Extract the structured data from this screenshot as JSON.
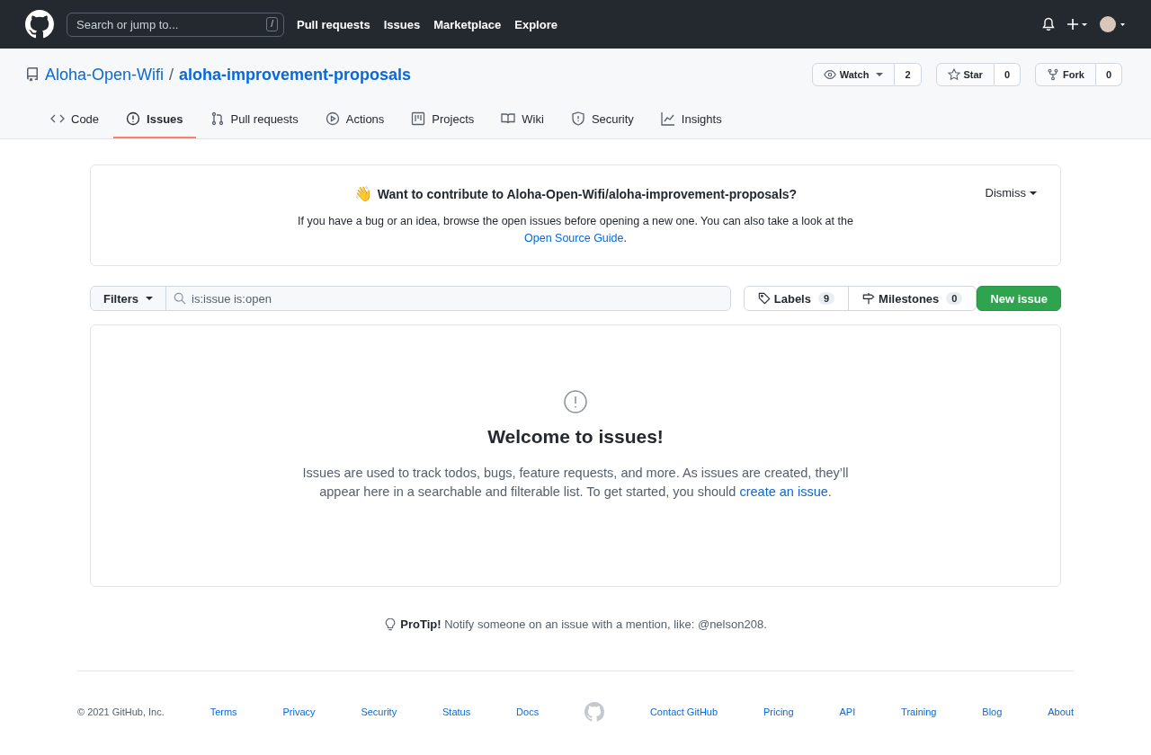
{
  "header": {
    "search_placeholder": "Search or jump to...",
    "slash_key": "/",
    "nav": [
      "Pull requests",
      "Issues",
      "Marketplace",
      "Explore"
    ]
  },
  "repo": {
    "owner": "Aloha-Open-Wifi",
    "separator": "/",
    "name": "aloha-improvement-proposals",
    "actions": [
      {
        "kind": "watch",
        "label": "Watch",
        "count": "2"
      },
      {
        "kind": "star",
        "label": "Star",
        "count": "0"
      },
      {
        "kind": "fork",
        "label": "Fork",
        "count": "0"
      }
    ]
  },
  "tabs": [
    {
      "kind": "code",
      "label": "Code",
      "selected": false
    },
    {
      "kind": "issues",
      "label": "Issues",
      "selected": true
    },
    {
      "kind": "pulls",
      "label": "Pull requests",
      "selected": false
    },
    {
      "kind": "actions",
      "label": "Actions",
      "selected": false
    },
    {
      "kind": "projects",
      "label": "Projects",
      "selected": false
    },
    {
      "kind": "wiki",
      "label": "Wiki",
      "selected": false
    },
    {
      "kind": "security",
      "label": "Security",
      "selected": false
    },
    {
      "kind": "insights",
      "label": "Insights",
      "selected": false
    }
  ],
  "banner": {
    "emoji": "👋",
    "title": "Want to contribute to Aloha-Open-Wifi/aloha-improvement-proposals?",
    "text": "If you have a bug or an idea, browse the open issues before opening a new one. You can also take a look at the",
    "link": "Open Source Guide",
    "after": ".",
    "dismiss": "Dismiss"
  },
  "toolbar": {
    "filters": "Filters",
    "search_value": "is:issue is:open",
    "labels": {
      "label": "Labels",
      "count": "9"
    },
    "milestones": {
      "label": "Milestones",
      "count": "0"
    },
    "new_issue": "New issue"
  },
  "blankslate": {
    "title": "Welcome to issues!",
    "text": "Issues are used to track todos, bugs, feature requests, and more. As issues are created, they’ll appear here in a searchable and filterable list. To get started, you should",
    "link": "create an issue",
    "after": "."
  },
  "protip": "**ProTip!** Notify someone on an issue with a mention, like: @nelson208.",
  "footer": {
    "copyright": "© 2021 GitHub, Inc.",
    "left_links": [
      "Terms",
      "Privacy",
      "Security",
      "Status",
      "Docs"
    ],
    "right_links": [
      "Contact GitHub",
      "Pricing",
      "API",
      "Training",
      "Blog",
      "About"
    ]
  }
}
